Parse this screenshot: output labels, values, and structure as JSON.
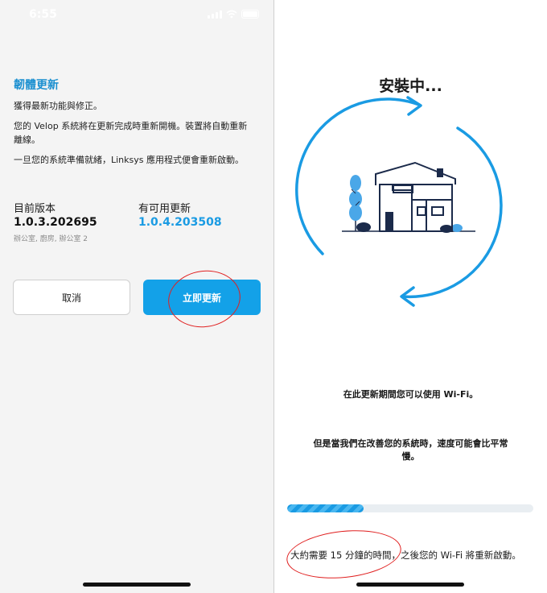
{
  "left": {
    "status": {
      "time": "6:55"
    },
    "title": "韌體更新",
    "line1": "獲得最新功能與修正。",
    "line2a": "您的 Velop 系統將在更新完成時重新開機。裝置將自動重新",
    "line2b": "離線。",
    "line3": "一旦您的系統準備就緒，Linksys 應用程式便會重新啟動。",
    "current_label": "目前版本",
    "current_version": "1.0.3.202695",
    "current_nodes": "辦公室, 廚房, 辦公室 2",
    "available_label": "有可用更新",
    "available_version": "1.0.4.203508",
    "cancel_label": "取消",
    "update_label": "立即更新"
  },
  "right": {
    "title": "安裝中...",
    "info1": "在此更新期間您可以使用 Wi-Fi。",
    "info2a": "但是當我們在改善您的系統時，速度可能會比平常",
    "info2b": "慢。",
    "progress_fraction": 0.31,
    "bottom_text": "大約需要 15 分鐘的時間，之後您的 Wi-Fi 將重新啟動。"
  },
  "colors": {
    "accent": "#13a1e8",
    "title_blue": "#1a8fd0",
    "annotation_red": "#e02020",
    "navy": "#1b2a4a"
  }
}
